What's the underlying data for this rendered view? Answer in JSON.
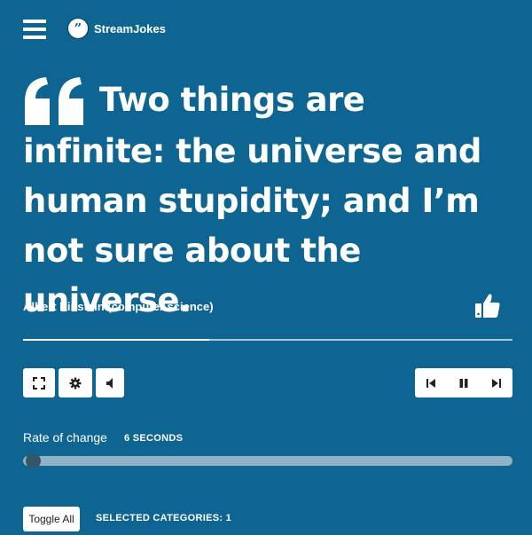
{
  "header": {
    "menu_icon": "hamburger-icon",
    "logo_icon": "quote-bubble-icon",
    "logo_text": "StreamJokes"
  },
  "quote": {
    "text": "Two things are infinite: the universe and human stupidity; and I’m not sure about the universe.",
    "author": "Albert Einstein (computer science)",
    "like_icon": "thumbs-up-icon"
  },
  "progress": {
    "value": 0.38
  },
  "controls": {
    "left": [
      "fullscreen-icon",
      "gear-icon",
      "volume-icon"
    ],
    "right": [
      "skip-previous-icon",
      "pause-icon",
      "skip-next-icon"
    ]
  },
  "rate": {
    "label": "Rate of change",
    "value": "6 SECONDS",
    "slider_fraction": 0.0
  },
  "categories": {
    "toggle_label": "Toggle All",
    "selected_text": "SELECTED CATEGORIES: 1"
  },
  "colors": {
    "background": "#0e6591",
    "foreground": "#ffffff",
    "slider_track": "#8fb2c6",
    "slider_thumb": "#35566a"
  }
}
